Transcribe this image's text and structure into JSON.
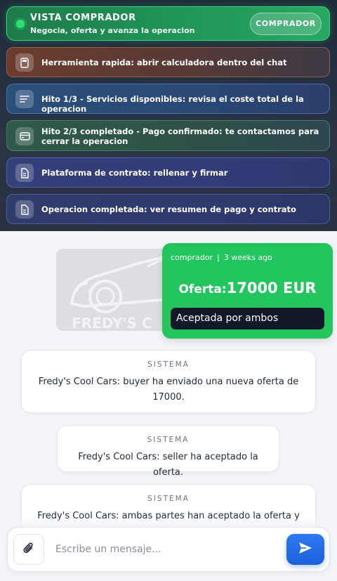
{
  "header": {
    "role_title": "VISTA COMPRADOR",
    "role_subtitle": "Negocia, oferta y avanza la operacion",
    "role_button": "COMPRADOR"
  },
  "steps": [
    {
      "icon": "calculator-icon",
      "label": "Herramienta rapida: abrir calculadora dentro del chat"
    },
    {
      "icon": "list-icon",
      "label": "Hito 1/3 - Servicios disponibles: revisa el coste total de la operacion"
    },
    {
      "icon": "card-icon",
      "label": "Hito 2/3 completado - Pago confirmado: te contactamos para cerrar la operacion"
    },
    {
      "icon": "document-icon",
      "label": "Plataforma de contrato: rellenar y firmar"
    },
    {
      "icon": "document-icon",
      "label": "Operacion completada: ver resumen de pago y contrato"
    }
  ],
  "chat": {
    "car_image_text": "FREDY'S C",
    "offer": {
      "sender": "comprador",
      "separator": "|",
      "time": "3 weeks ago",
      "label": "Oferta:",
      "amount": "17000 EUR",
      "status": "Aceptada por ambos"
    },
    "system_messages": [
      {
        "tag": "SISTEMA",
        "text": "Fredy's Cool Cars: buyer ha enviado una nueva oferta de 17000."
      },
      {
        "tag": "SISTEMA",
        "text": "Fredy's Cool Cars: seller ha aceptado la oferta."
      },
      {
        "tag": "SISTEMA",
        "text": "Fredy's Cool Cars: ambas partes han aceptado la oferta y la"
      }
    ]
  },
  "composer": {
    "placeholder": "Escribe un mensaje..."
  },
  "colors": {
    "role_green": "#1f8f54",
    "offer_green": "#22c55e",
    "send_blue": "#2563eb",
    "status_dark": "#111827"
  }
}
